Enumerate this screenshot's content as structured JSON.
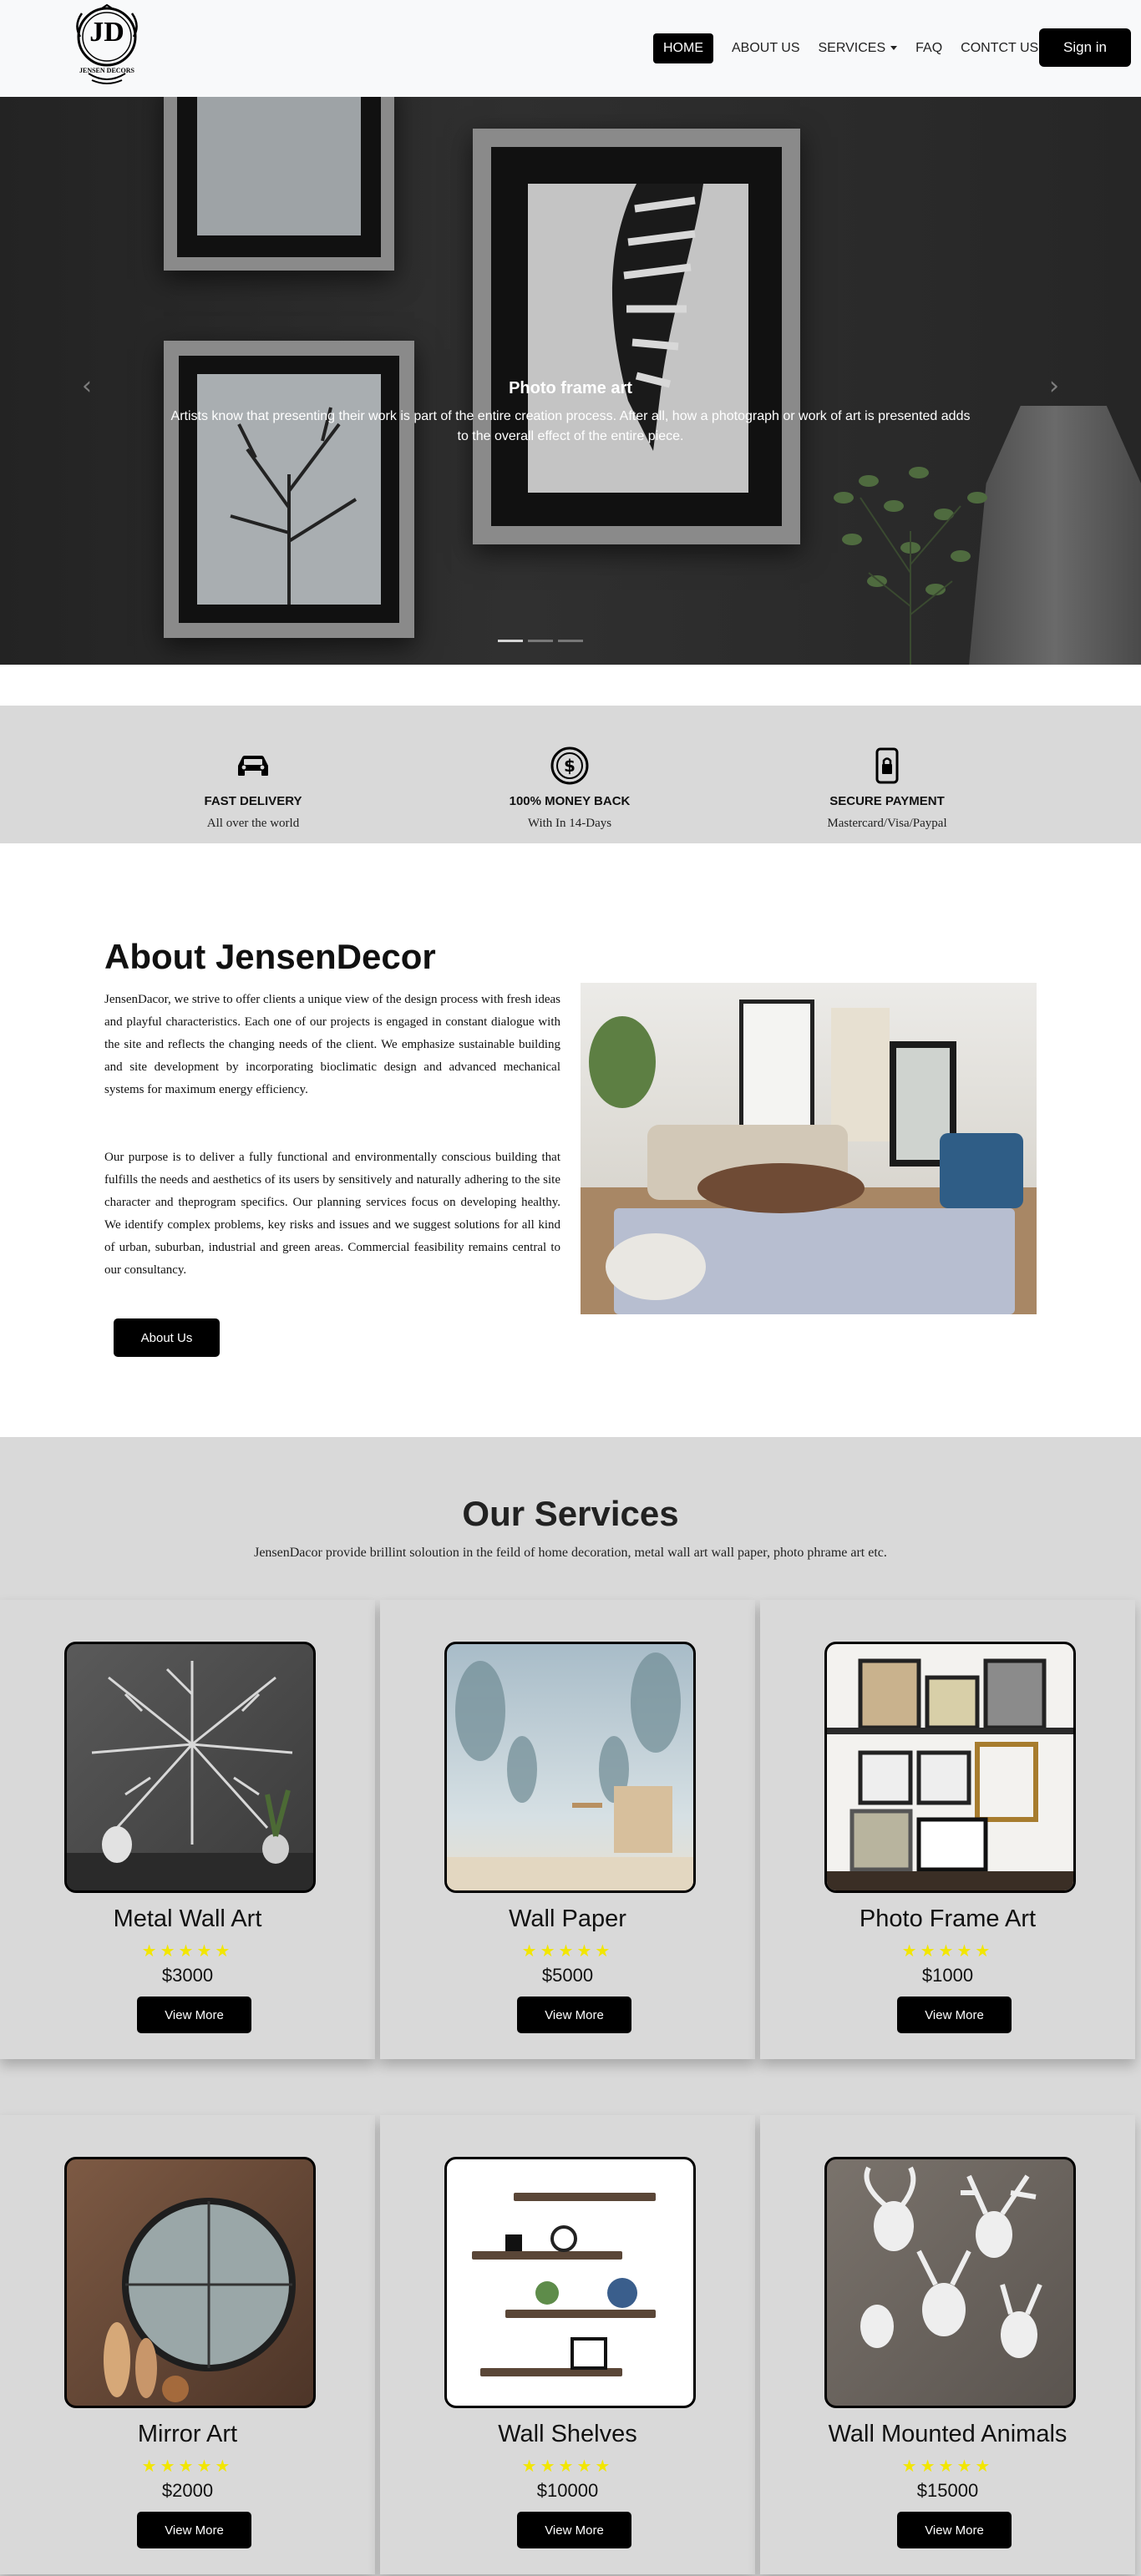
{
  "brand": {
    "logo_monogram": "JD",
    "logo_name": "JENSEN DECORS"
  },
  "nav": {
    "items": [
      {
        "label": "HOME",
        "active": true
      },
      {
        "label": "ABOUT US"
      },
      {
        "label": "SERVICES",
        "dropdown": true
      },
      {
        "label": "FAQ"
      },
      {
        "label": "CONTCT US"
      }
    ],
    "signin_label": "Sign in"
  },
  "hero": {
    "title": "Photo frame art",
    "text": "Artists know that presenting their work is part of the entire creation process. After all, how a photograph or work of art is presented adds to the overall effect of the entire piece.",
    "prev_icon": "chevron-left-icon",
    "next_icon": "chevron-right-icon",
    "slides": 3,
    "active_slide": 1
  },
  "features": [
    {
      "icon": "car-icon",
      "title": "FAST DELIVERY",
      "subtitle": "All over the world"
    },
    {
      "icon": "dollar-icon",
      "title": "100% MONEY BACK",
      "subtitle": "With In 14-Days"
    },
    {
      "icon": "lock-icon",
      "title": "SECURE PAYMENT",
      "subtitle": "Mastercard/Visa/Paypal"
    }
  ],
  "about": {
    "title": "About JensenDecor",
    "paragraph1": "JensenDacor, we strive to offer clients a unique view of the design process with fresh ideas and playful characteristics. Each one of our projects is engaged in constant dialogue with the site and reflects the changing needs of the client. We emphasize sustainable building and site development by incorporating bioclimatic design and advanced mechanical systems for maximum energy efficiency.",
    "paragraph2": "Our purpose is to deliver a fully functional and environmentally conscious building that fulfills the needs and aesthetics of its users by sensitively and naturally adhering to the site character and theprogram specifics. Our planning services focus on developing healthy. We identify complex problems, key risks and issues and we suggest solutions for all kind of urban, suburban, industrial and green areas. Commercial feasibility remains central to our consultancy.",
    "button_label": "About Us"
  },
  "services": {
    "title": "Our Services",
    "subtitle": "JensenDacor provide brillint soloution in the feild of home decoration, metal wall art wall paper, photo phrame art etc.",
    "rating_stars": "★★★★★",
    "button_label": "View More",
    "items": [
      {
        "name": "Metal Wall Art",
        "price": "$3000",
        "rating": 5
      },
      {
        "name": "Wall Paper",
        "price": "$5000",
        "rating": 5
      },
      {
        "name": "Photo Frame Art",
        "price": "$1000",
        "rating": 5
      },
      {
        "name": "Mirror Art",
        "price": "$2000",
        "rating": 5
      },
      {
        "name": "Wall Shelves",
        "price": "$10000",
        "rating": 5
      },
      {
        "name": "Wall Mounted Animals",
        "price": "$15000",
        "rating": 5
      }
    ]
  },
  "colors": {
    "accent": "#000000",
    "band": "#d9d9d9",
    "star": "#f2e600",
    "nav_bg": "#f8f9fa"
  }
}
